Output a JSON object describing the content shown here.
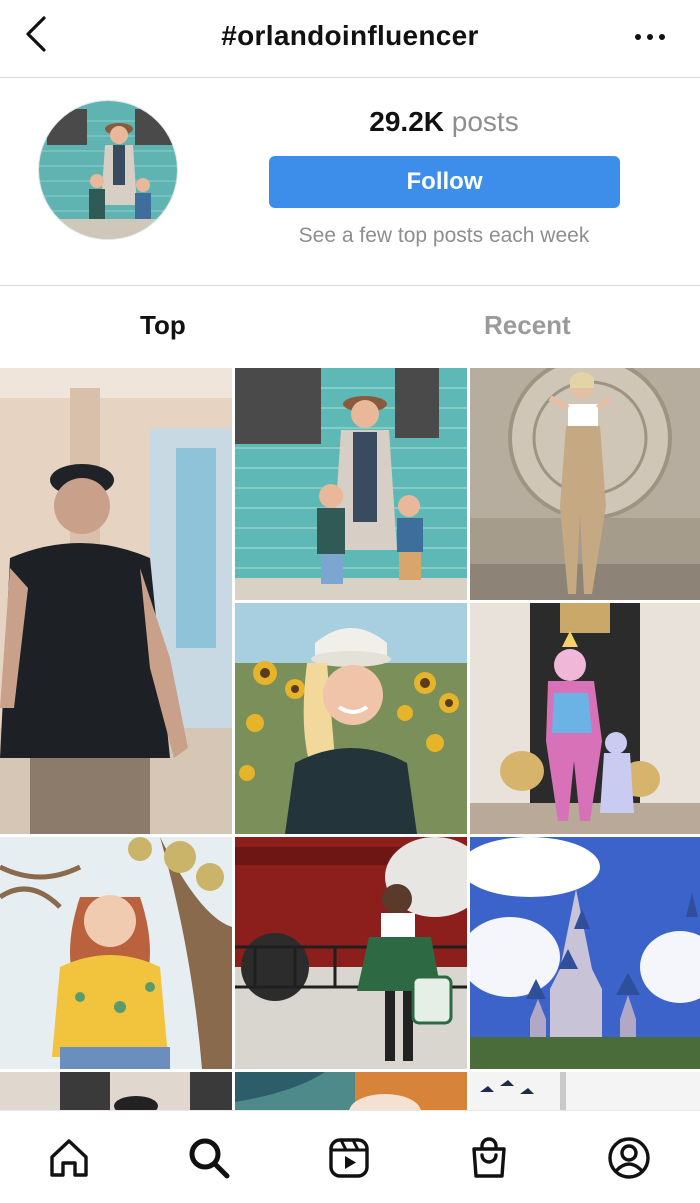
{
  "header": {
    "title": "#orlandoinfluencer",
    "back_icon": "chevron-left-icon",
    "more_icon": "more-horizontal-icon"
  },
  "profile": {
    "post_count": "29.2K",
    "post_unit": "posts",
    "follow_label": "Follow",
    "note": "See a few top posts each week",
    "accent_color": "#3d8eeb"
  },
  "tabs": [
    {
      "label": "Top",
      "active": true
    },
    {
      "label": "Recent",
      "active": false
    }
  ],
  "grid": {
    "posts": [
      {
        "subject": "man in black shirt walking",
        "type": "reel"
      },
      {
        "subject": "mother with two children by teal brick wall",
        "type": "photo"
      },
      {
        "subject": "woman posing in front of stone fountain",
        "type": "photo"
      },
      {
        "subject": "woman in cap in sunflower field",
        "type": "photo"
      },
      {
        "subject": "mother and child in unicorn costumes",
        "type": "photo"
      },
      {
        "subject": "woman in floral top under tree",
        "type": "photo"
      },
      {
        "subject": "woman in plaid skirt by Hogwarts train",
        "type": "photo"
      },
      {
        "subject": "Cinderella castle under blue sky",
        "type": "photo"
      }
    ]
  },
  "bottom_nav": {
    "items": [
      "home-icon",
      "search-icon",
      "reels-icon",
      "shop-icon",
      "profile-icon"
    ],
    "active": "search-icon"
  }
}
